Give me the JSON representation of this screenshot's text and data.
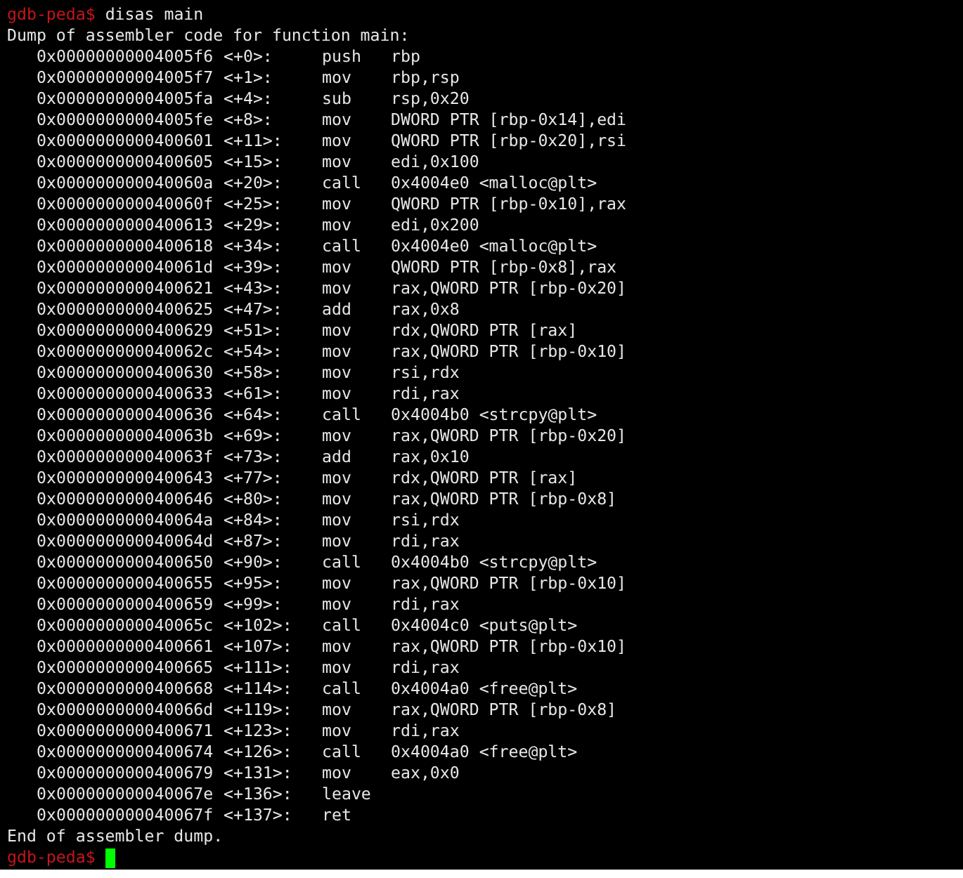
{
  "prompt_line": {
    "prompt": "gdb-peda$",
    "command": "disas main"
  },
  "header": "Dump of assembler code for function main:",
  "instructions": [
    {
      "address": "0x00000000004005f6",
      "offset": "<+0>:",
      "mnemonic": "push",
      "operands": "rbp"
    },
    {
      "address": "0x00000000004005f7",
      "offset": "<+1>:",
      "mnemonic": "mov",
      "operands": "rbp,rsp"
    },
    {
      "address": "0x00000000004005fa",
      "offset": "<+4>:",
      "mnemonic": "sub",
      "operands": "rsp,0x20"
    },
    {
      "address": "0x00000000004005fe",
      "offset": "<+8>:",
      "mnemonic": "mov",
      "operands": "DWORD PTR [rbp-0x14],edi"
    },
    {
      "address": "0x0000000000400601",
      "offset": "<+11>:",
      "mnemonic": "mov",
      "operands": "QWORD PTR [rbp-0x20],rsi"
    },
    {
      "address": "0x0000000000400605",
      "offset": "<+15>:",
      "mnemonic": "mov",
      "operands": "edi,0x100"
    },
    {
      "address": "0x000000000040060a",
      "offset": "<+20>:",
      "mnemonic": "call",
      "operands": "0x4004e0 <malloc@plt>"
    },
    {
      "address": "0x000000000040060f",
      "offset": "<+25>:",
      "mnemonic": "mov",
      "operands": "QWORD PTR [rbp-0x10],rax"
    },
    {
      "address": "0x0000000000400613",
      "offset": "<+29>:",
      "mnemonic": "mov",
      "operands": "edi,0x200"
    },
    {
      "address": "0x0000000000400618",
      "offset": "<+34>:",
      "mnemonic": "call",
      "operands": "0x4004e0 <malloc@plt>"
    },
    {
      "address": "0x000000000040061d",
      "offset": "<+39>:",
      "mnemonic": "mov",
      "operands": "QWORD PTR [rbp-0x8],rax"
    },
    {
      "address": "0x0000000000400621",
      "offset": "<+43>:",
      "mnemonic": "mov",
      "operands": "rax,QWORD PTR [rbp-0x20]"
    },
    {
      "address": "0x0000000000400625",
      "offset": "<+47>:",
      "mnemonic": "add",
      "operands": "rax,0x8"
    },
    {
      "address": "0x0000000000400629",
      "offset": "<+51>:",
      "mnemonic": "mov",
      "operands": "rdx,QWORD PTR [rax]"
    },
    {
      "address": "0x000000000040062c",
      "offset": "<+54>:",
      "mnemonic": "mov",
      "operands": "rax,QWORD PTR [rbp-0x10]"
    },
    {
      "address": "0x0000000000400630",
      "offset": "<+58>:",
      "mnemonic": "mov",
      "operands": "rsi,rdx"
    },
    {
      "address": "0x0000000000400633",
      "offset": "<+61>:",
      "mnemonic": "mov",
      "operands": "rdi,rax"
    },
    {
      "address": "0x0000000000400636",
      "offset": "<+64>:",
      "mnemonic": "call",
      "operands": "0x4004b0 <strcpy@plt>"
    },
    {
      "address": "0x000000000040063b",
      "offset": "<+69>:",
      "mnemonic": "mov",
      "operands": "rax,QWORD PTR [rbp-0x20]"
    },
    {
      "address": "0x000000000040063f",
      "offset": "<+73>:",
      "mnemonic": "add",
      "operands": "rax,0x10"
    },
    {
      "address": "0x0000000000400643",
      "offset": "<+77>:",
      "mnemonic": "mov",
      "operands": "rdx,QWORD PTR [rax]"
    },
    {
      "address": "0x0000000000400646",
      "offset": "<+80>:",
      "mnemonic": "mov",
      "operands": "rax,QWORD PTR [rbp-0x8]"
    },
    {
      "address": "0x000000000040064a",
      "offset": "<+84>:",
      "mnemonic": "mov",
      "operands": "rsi,rdx"
    },
    {
      "address": "0x000000000040064d",
      "offset": "<+87>:",
      "mnemonic": "mov",
      "operands": "rdi,rax"
    },
    {
      "address": "0x0000000000400650",
      "offset": "<+90>:",
      "mnemonic": "call",
      "operands": "0x4004b0 <strcpy@plt>"
    },
    {
      "address": "0x0000000000400655",
      "offset": "<+95>:",
      "mnemonic": "mov",
      "operands": "rax,QWORD PTR [rbp-0x10]"
    },
    {
      "address": "0x0000000000400659",
      "offset": "<+99>:",
      "mnemonic": "mov",
      "operands": "rdi,rax"
    },
    {
      "address": "0x000000000040065c",
      "offset": "<+102>:",
      "mnemonic": "call",
      "operands": "0x4004c0 <puts@plt>"
    },
    {
      "address": "0x0000000000400661",
      "offset": "<+107>:",
      "mnemonic": "mov",
      "operands": "rax,QWORD PTR [rbp-0x10]"
    },
    {
      "address": "0x0000000000400665",
      "offset": "<+111>:",
      "mnemonic": "mov",
      "operands": "rdi,rax"
    },
    {
      "address": "0x0000000000400668",
      "offset": "<+114>:",
      "mnemonic": "call",
      "operands": "0x4004a0 <free@plt>"
    },
    {
      "address": "0x000000000040066d",
      "offset": "<+119>:",
      "mnemonic": "mov",
      "operands": "rax,QWORD PTR [rbp-0x8]"
    },
    {
      "address": "0x0000000000400671",
      "offset": "<+123>:",
      "mnemonic": "mov",
      "operands": "rdi,rax"
    },
    {
      "address": "0x0000000000400674",
      "offset": "<+126>:",
      "mnemonic": "call",
      "operands": "0x4004a0 <free@plt>"
    },
    {
      "address": "0x0000000000400679",
      "offset": "<+131>:",
      "mnemonic": "mov",
      "operands": "eax,0x0"
    },
    {
      "address": "0x000000000040067e",
      "offset": "<+136>:",
      "mnemonic": "leave"
    },
    {
      "address": "0x000000000040067f",
      "offset": "<+137>:",
      "mnemonic": "ret"
    }
  ],
  "footer": "End of assembler dump.",
  "final_prompt": {
    "prompt": "gdb-peda$",
    "cursor": true
  }
}
